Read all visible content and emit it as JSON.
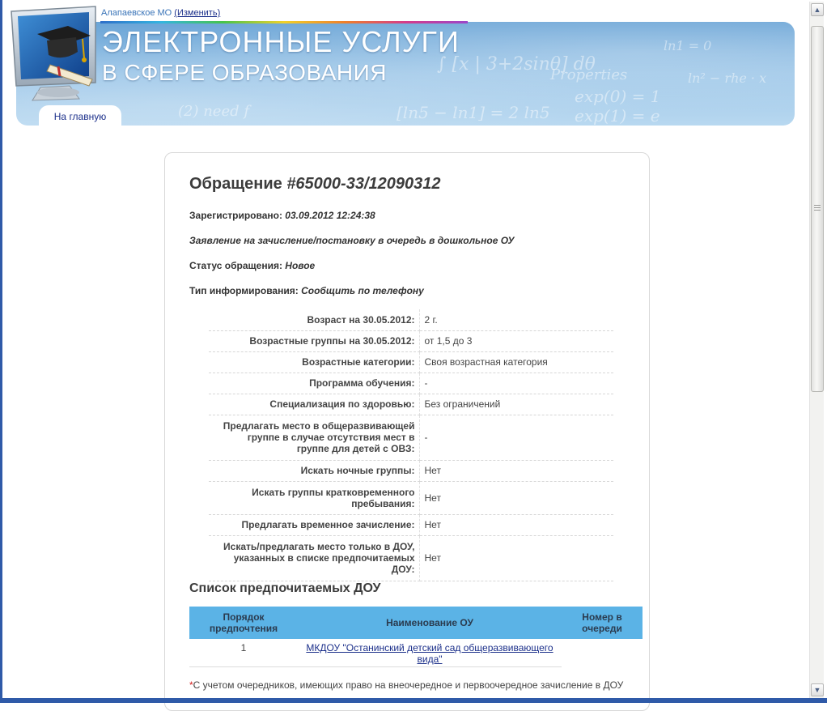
{
  "header": {
    "region_name": "Алапаевское МО",
    "region_change_link": "(Изменить)",
    "title_line1": "ЭЛЕКТРОННЫЕ УСЛУГИ",
    "title_line2": "В СФЕРЕ ОБРАЗОВАНИЯ",
    "home_tab": "На главную"
  },
  "request": {
    "title_prefix": "Обращение ",
    "number": "#65000-33/12090312",
    "registered_label": "Зарегистрировано: ",
    "registered_value": "03.09.2012 12:24:38",
    "application_type": "Заявление на зачисление/постановку в очередь в дошкольное ОУ",
    "status_label": "Статус обращения: ",
    "status_value": "Новое",
    "notify_label": "Тип информирования: ",
    "notify_value": "Сообщить по телефону"
  },
  "details": [
    {
      "label": "Возраст на 30.05.2012:",
      "value": "2 г."
    },
    {
      "label": "Возрастные группы на 30.05.2012:",
      "value": "от 1,5 до 3"
    },
    {
      "label": "Возрастные категории:",
      "value": "Своя возрастная категория"
    },
    {
      "label": "Программа обучения:",
      "value": "-"
    },
    {
      "label": "Специализация по здоровью:",
      "value": "Без ограничений"
    },
    {
      "label": "Предлагать место в общеразвивающей группе в случае отсутствия мест в группе для детей с ОВЗ:",
      "value": "-"
    },
    {
      "label": "Искать ночные группы:",
      "value": "Нет"
    },
    {
      "label": "Искать группы кратковременного пребывания:",
      "value": "Нет"
    },
    {
      "label": "Предлагать временное зачисление:",
      "value": "Нет"
    },
    {
      "label": "Искать/предлагать место только в ДОУ, указанных в списке предпочитаемых ДОУ:",
      "value": "Нет"
    }
  ],
  "preferred": {
    "heading": "Список предпочитаемых ДОУ",
    "columns": [
      "Порядок предпочтения",
      "Наименование ОУ",
      "Номер в очереди"
    ],
    "rows": [
      {
        "order": "1",
        "name": "МКДОУ \"Останинский детский сад общеразвивающего вида\"",
        "queue": ""
      }
    ]
  },
  "footnote": {
    "star": "*",
    "text": "С учетом очередников, имеющих право на внеочередное и первоочередное зачисление в ДОУ"
  },
  "colors": {
    "header_blue": "#6aa4d6",
    "table_header": "#5bb3e6",
    "link": "#1b2f8a",
    "asterisk": "#d21c1c"
  }
}
